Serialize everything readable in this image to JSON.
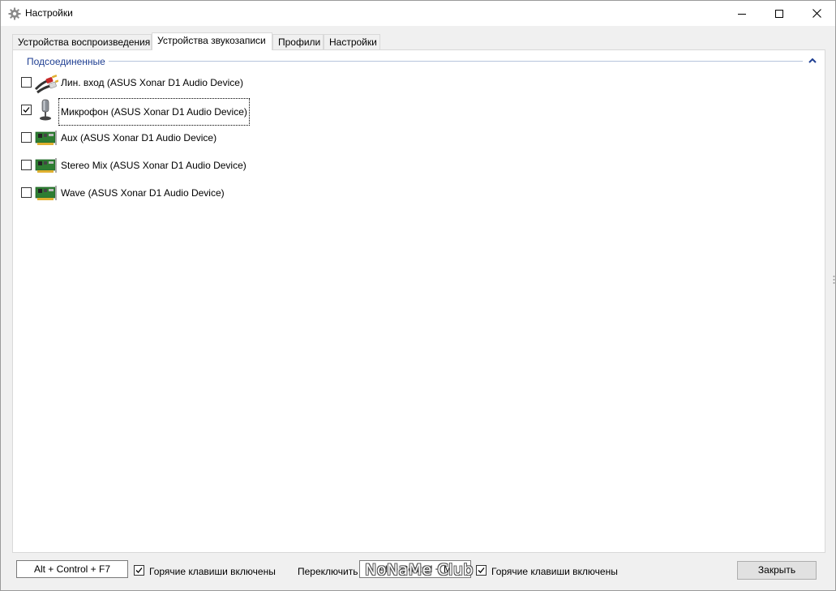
{
  "window": {
    "title": "Настройки",
    "icon": "gear-icon"
  },
  "tabs": [
    {
      "label": "Устройства воспроизведения",
      "active": false
    },
    {
      "label": "Устройства звукозаписи",
      "active": true
    },
    {
      "label": "Профили",
      "active": false
    },
    {
      "label": "Настройки",
      "active": false
    }
  ],
  "group": {
    "header": "Подсоединенные",
    "collapse_icon": "chevron-up-icon"
  },
  "devices": [
    {
      "label": "Лин. вход (ASUS Xonar D1 Audio Device)",
      "checked": false,
      "icon": "rca-cable-icon"
    },
    {
      "label": "Микрофон (ASUS Xonar D1 Audio Device)",
      "checked": true,
      "icon": "microphone-icon"
    },
    {
      "label": "Aux (ASUS Xonar D1 Audio Device)",
      "checked": false,
      "icon": "sound-card-icon"
    },
    {
      "label": "Stereo Mix (ASUS Xonar D1 Audio Device)",
      "checked": false,
      "icon": "sound-card-icon"
    },
    {
      "label": "Wave (ASUS Xonar D1 Audio Device)",
      "checked": false,
      "icon": "sound-card-icon"
    }
  ],
  "bottom": {
    "hotkey1": "Alt + Control + F7",
    "hotkey1_enabled_label": "Горячие клавиши включены",
    "switch_label": "Переключить",
    "hotkey2": "Alt + Control + M",
    "hotkey2_enabled_label": "Горячие клавиши включены",
    "close_label": "Закрыть",
    "watermark": "NoNaMe Club"
  }
}
